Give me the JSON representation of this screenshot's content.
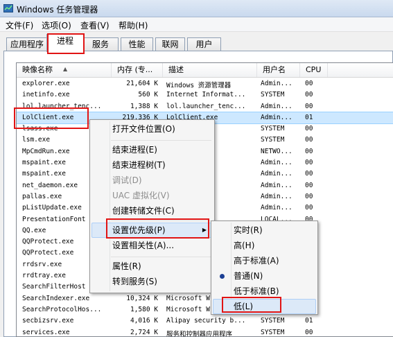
{
  "window": {
    "title": "Windows 任务管理器",
    "icon": "task-manager-icon"
  },
  "menubar": [
    "文件(F)",
    "选项(O)",
    "查看(V)",
    "帮助(H)"
  ],
  "tabs": [
    "应用程序",
    "进程",
    "服务",
    "性能",
    "联网",
    "用户"
  ],
  "active_tab": "进程",
  "columns": [
    "映像名称",
    "内存 (专...",
    "描述",
    "用户名",
    "CPU"
  ],
  "rows": [
    [
      "explorer.exe",
      "21,604 K",
      "Windows 资源管理器",
      "Admin...",
      "00"
    ],
    [
      "inetinfo.exe",
      "560 K",
      "Internet Informat...",
      "SYSTEM",
      "00"
    ],
    [
      "lol.launcher_tenc...",
      "1,388 K",
      "lol.launcher_tenc...",
      "Admin...",
      "00"
    ],
    [
      "LolClient.exe",
      "219,336 K",
      "LolClient.exe",
      "Admin...",
      "01"
    ],
    [
      "lsass.exe",
      "",
      "ty Au...",
      "SYSTEM",
      "00"
    ],
    [
      "lsm.exe",
      "",
      "理器服务",
      "SYSTEM",
      "00"
    ],
    [
      "MpCmdRun.exe",
      "",
      "alware...",
      "NETWO...",
      "00"
    ],
    [
      "mspaint.exe",
      "",
      "",
      "Admin...",
      "00"
    ],
    [
      "mspaint.exe",
      "",
      "",
      "Admin...",
      "00"
    ],
    [
      "net_daemon.exe",
      "",
      "理和发...",
      "Admin...",
      "00"
    ],
    [
      "pallas.exe",
      "",
      "Pallas",
      "Admin...",
      "00"
    ],
    [
      "pListUpdate.exe",
      "",
      "exe",
      "Admin...",
      "00"
    ],
    [
      "PresentationFont",
      "",
      "tionFontC...",
      "LOCAL...",
      "00"
    ],
    [
      "QQ.exe",
      "",
      "",
      "Admin...",
      "00"
    ],
    [
      "QQProtect.exe",
      "",
      "",
      "",
      ""
    ],
    [
      "QQProtect.exe",
      "",
      "",
      "",
      ""
    ],
    [
      "rrdsrv.exe",
      "",
      "",
      "",
      ""
    ],
    [
      "rrdtray.exe",
      "",
      "",
      "",
      ""
    ],
    [
      "SearchFilterHost",
      "",
      "",
      "",
      ""
    ],
    [
      "SearchIndexer.exe",
      "10,324 K",
      "Microsoft W",
      "",
      ""
    ],
    [
      "SearchProtocolHos...",
      "1,580 K",
      "Microsoft W",
      "",
      ""
    ],
    [
      "secbizsrv.exe",
      "4,016 K",
      "Alipay security b...",
      "SYSTEM",
      "01"
    ],
    [
      "services.exe",
      "2,724 K",
      "服务和控制器应用程序",
      "SYSTEM",
      "00"
    ]
  ],
  "selected_row": "LolClient.exe",
  "context_menu": {
    "items": [
      {
        "label": "打开文件位置(O)",
        "disabled": false
      },
      {
        "label": "结束进程(E)",
        "disabled": false
      },
      {
        "label": "结束进程树(T)",
        "disabled": false
      },
      {
        "label": "调试(D)",
        "disabled": true
      },
      {
        "label": "UAC 虚拟化(V)",
        "disabled": true
      },
      {
        "label": "创建转储文件(C)",
        "disabled": false
      },
      {
        "label": "设置优先级(P)",
        "disabled": false,
        "submenu": true,
        "highlighted": true
      },
      {
        "label": "设置相关性(A)...",
        "disabled": false
      },
      {
        "label": "属性(R)",
        "disabled": false
      },
      {
        "label": "转到服务(S)",
        "disabled": false
      }
    ]
  },
  "priority_submenu": {
    "items": [
      "实时(R)",
      "高(H)",
      "高于标准(A)",
      "普通(N)",
      "低于标准(B)",
      "低(L)"
    ],
    "checked": "普通(N)",
    "highlighted": "低(L)"
  },
  "colors": {
    "selection": "#cde8ff",
    "menu_highlight": "#dce9f8",
    "annotation_red": "#e11414"
  }
}
